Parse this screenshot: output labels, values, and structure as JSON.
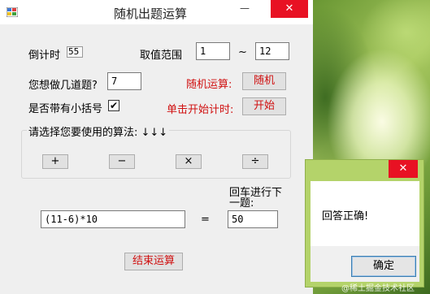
{
  "window": {
    "title": "随机出题运算",
    "minimize_glyph": "—",
    "close_glyph": "✕"
  },
  "countdown": {
    "label": "倒计时",
    "value": "55"
  },
  "range": {
    "label": "取值范围",
    "min": "1",
    "separator": "~",
    "max": "12"
  },
  "question_count": {
    "label": "您想做几道题?",
    "value": "7"
  },
  "random_op": {
    "label": "随机运算:",
    "button": "随机"
  },
  "brackets": {
    "label": "是否带有小括号",
    "checked_glyph": "✔"
  },
  "timer": {
    "label": "单击开始计时:",
    "button": "开始"
  },
  "algorithm": {
    "legend": "请选择您要使用的算法: ↓↓↓",
    "buttons": [
      "+",
      "−",
      "×",
      "÷"
    ]
  },
  "question": {
    "expression": "(11-6)*10",
    "equals": "=",
    "next_hint": "回车进行下一题:",
    "answer": "50"
  },
  "end_button": "结束运算",
  "dialog": {
    "close_glyph": "✕",
    "message": "回答正确!",
    "ok": "确定"
  },
  "watermark": "@稀土掘金技术社区",
  "icons": {
    "app": "app-icon",
    "checkmark": "checkmark-icon"
  },
  "colors": {
    "accent_red": "#d01010",
    "close_red": "#e81123",
    "dialog_frame": "#b4d36a"
  }
}
